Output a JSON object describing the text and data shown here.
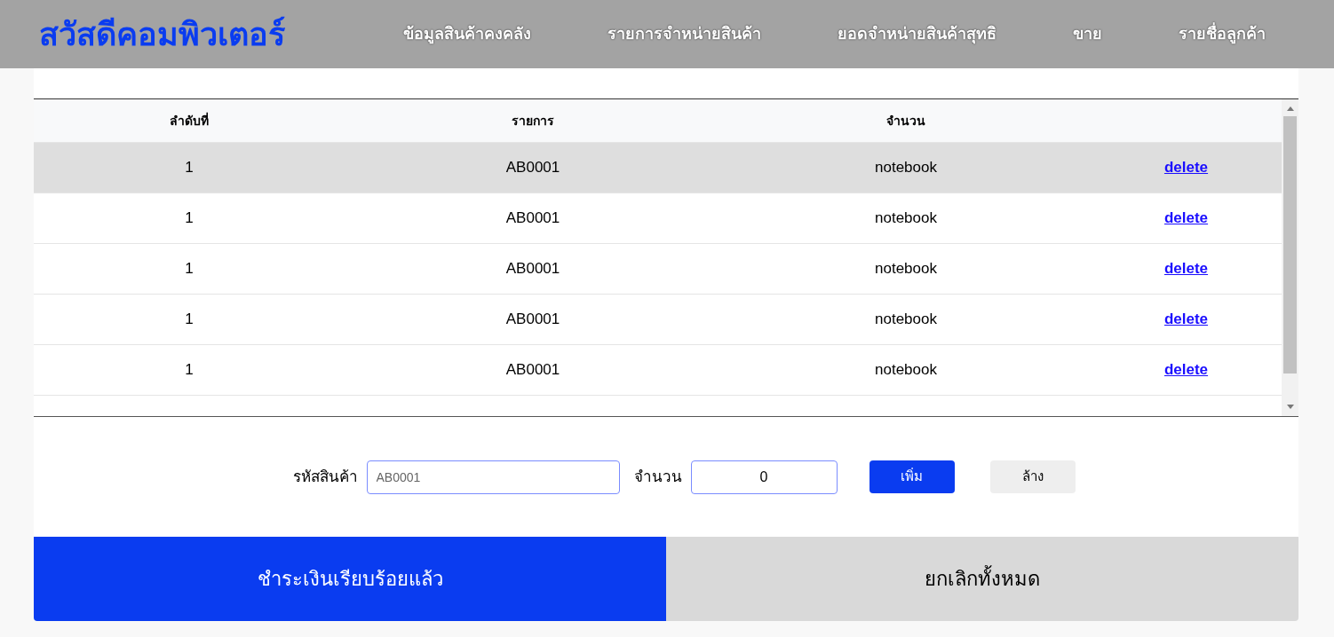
{
  "header": {
    "logo": "สวัสดีคอมพิวเตอร์",
    "nav": [
      {
        "label": "ข้อมูลสินค้าคงคลัง",
        "selected": false
      },
      {
        "label": "รายการจำหน่ายสินค้า",
        "selected": false
      },
      {
        "label": "ยอดจำหน่ายสินค้าสุทธิ",
        "selected": false
      },
      {
        "label": "ขาย",
        "selected": false
      },
      {
        "label": "รายชื่อลูกค้า",
        "selected": false
      }
    ]
  },
  "table": {
    "columns": [
      "ลำดับที่",
      "รายการ",
      "จำนวน"
    ],
    "rows": [
      {
        "cells": [
          "1",
          "AB0001",
          "notebook"
        ],
        "action": "delete",
        "selected": true
      },
      {
        "cells": [
          "1",
          "AB0001",
          "notebook"
        ],
        "action": "delete",
        "selected": false
      },
      {
        "cells": [
          "1",
          "AB0001",
          "notebook"
        ],
        "action": "delete",
        "selected": false
      },
      {
        "cells": [
          "1",
          "AB0001",
          "notebook"
        ],
        "action": "delete",
        "selected": false
      },
      {
        "cells": [
          "1",
          "AB0001",
          "notebook"
        ],
        "action": "delete",
        "selected": false
      }
    ]
  },
  "form": {
    "code_label": "รหัสสินค้า",
    "code_placeholder": "AB0001",
    "qty_label": "จำนวน",
    "qty_value": "0",
    "add_button": "เพิ่ม",
    "clear_button": "ล้าง"
  },
  "actions": {
    "pay_button": "ชำระเงินเรียบร้อยแล้ว",
    "cancel_button": "ยกเลิกทั้งหมด"
  }
}
